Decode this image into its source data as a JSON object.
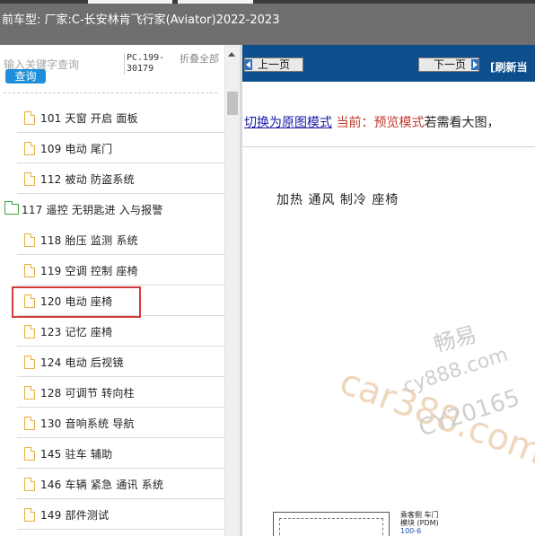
{
  "header": {
    "title": "前车型: 厂家:C-长安林肯飞行家(Aviator)2022-2023"
  },
  "sidebar": {
    "search_placeholder": "输入关键字查询",
    "search_button": "查询",
    "pc_code": "PC.199-30179",
    "collapse_all": "折叠全部",
    "items": [
      {
        "label": "101 天窗 开启 面板",
        "type": "doc"
      },
      {
        "label": "109 电动 尾门",
        "type": "doc"
      },
      {
        "label": "112 被动 防盗系统",
        "type": "doc"
      },
      {
        "label": "117 遥控 无钥匙进 入与报警",
        "type": "folder"
      },
      {
        "label": "118 胎压 监测 系统",
        "type": "doc"
      },
      {
        "label": "119 空调 控制 座椅",
        "type": "doc"
      },
      {
        "label": "120 电动 座椅",
        "type": "doc",
        "selected": true
      },
      {
        "label": "123 记忆 座椅",
        "type": "doc"
      },
      {
        "label": "124 电动 后视镜",
        "type": "doc"
      },
      {
        "label": "128 可调节 转向柱",
        "type": "doc"
      },
      {
        "label": "130 音响系统 导航",
        "type": "doc"
      },
      {
        "label": "145 驻车 辅助",
        "type": "doc"
      },
      {
        "label": "146 车辆 紧急 通讯 系统",
        "type": "doc"
      },
      {
        "label": "149 部件测试",
        "type": "doc"
      }
    ]
  },
  "content": {
    "prev_button": "上一页",
    "next_button": "下一页",
    "refresh_link": "[刷新当",
    "mode": {
      "switch_link": "切换为原图模式",
      "current_label": "当前：预览模式",
      "hint": "若需看大图，"
    },
    "doc_title": "加热 通风 制冷 座椅",
    "watermark": {
      "line1": "畅易",
      "line2": "car388.com",
      "line3": "cy888.com",
      "line4": "CY20165"
    },
    "diagram": {
      "label_line1": "乘客侧 车门",
      "label_line2": "模块 (PDM)",
      "label_line3": "100-6"
    }
  },
  "colors": {
    "header_bg": "#6f6f6f",
    "navbar_bg": "#0d4f8c",
    "search_button_bg": "#1e8fd8",
    "highlight": "#d23c3c",
    "link": "#1a1aa8",
    "mode_current": "#c0392b"
  }
}
